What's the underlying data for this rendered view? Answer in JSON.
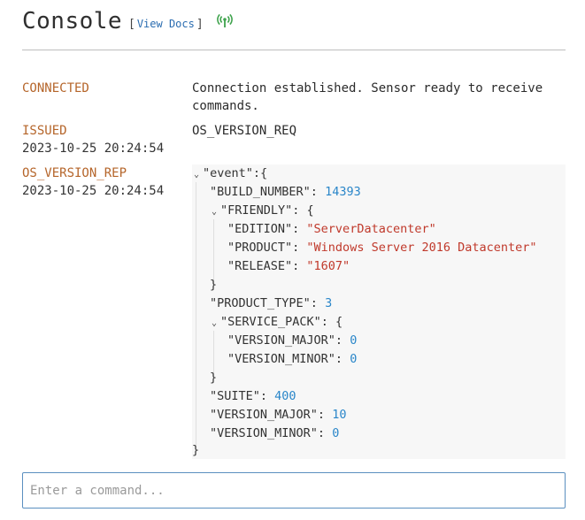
{
  "header": {
    "title": "Console",
    "docs_bracket_open": "[",
    "docs_link": "View Docs",
    "docs_bracket_close": "]",
    "status_icon": "antenna-signal-icon",
    "status_color": "#3fa34d"
  },
  "entries": [
    {
      "type": "CONNECTED",
      "time": "",
      "message_line1": "Connection established. Sensor ready to receive",
      "message_line2": "commands."
    },
    {
      "type": "ISSUED",
      "time": "2023-10-25 20:24:54",
      "message_line1": "OS_VERSION_REQ"
    },
    {
      "type": "OS_VERSION_REP",
      "time": "2023-10-25 20:24:54"
    }
  ],
  "json": {
    "root_key": "\"event\"",
    "build_number_key": "\"BUILD_NUMBER\"",
    "build_number": "14393",
    "friendly_key": "\"FRIENDLY\"",
    "edition_key": "\"EDITION\"",
    "edition": "\"ServerDatacenter\"",
    "product_key": "\"PRODUCT\"",
    "product": "\"Windows Server 2016 Datacenter\"",
    "release_key": "\"RELEASE\"",
    "release": "\"1607\"",
    "product_type_key": "\"PRODUCT_TYPE\"",
    "product_type": "3",
    "service_pack_key": "\"SERVICE_PACK\"",
    "sp_major_key": "\"VERSION_MAJOR\"",
    "sp_major": "0",
    "sp_minor_key": "\"VERSION_MINOR\"",
    "sp_minor": "0",
    "suite_key": "\"SUITE\"",
    "suite": "400",
    "version_major_key": "\"VERSION_MAJOR\"",
    "version_major": "10",
    "version_minor_key": "\"VERSION_MINOR\"",
    "version_minor": "0"
  },
  "command": {
    "placeholder": "Enter a command...",
    "value": ""
  },
  "colors": {
    "event_type": "#b5652a",
    "json_number": "#2a86c9",
    "json_string": "#c0392b",
    "link": "#2a6cb0"
  }
}
